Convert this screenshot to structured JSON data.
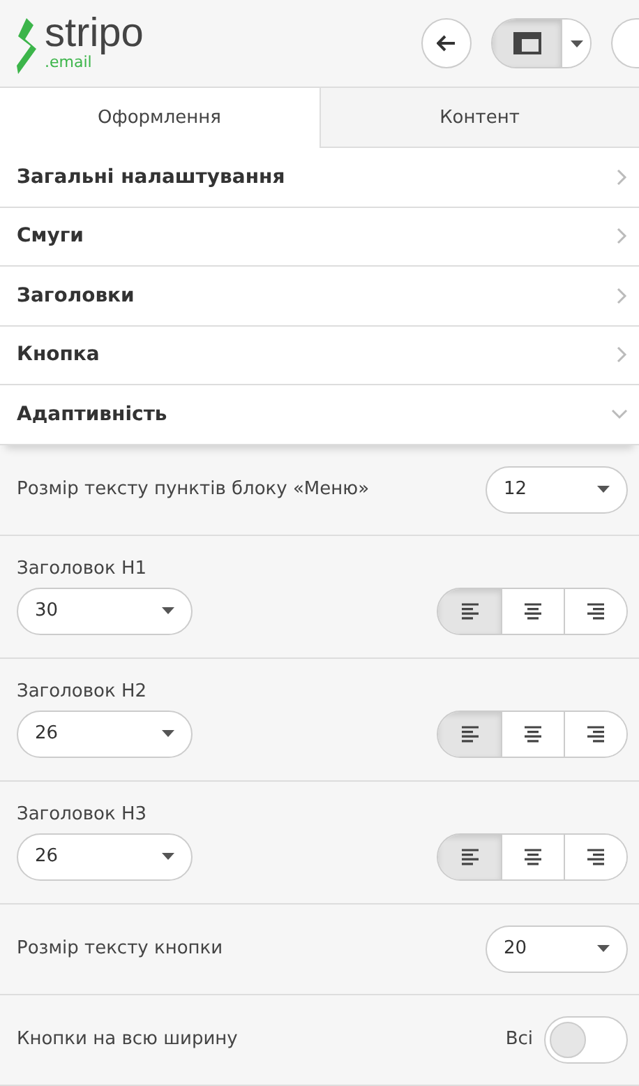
{
  "logo": {
    "name": "stripo",
    "suffix": ".email"
  },
  "toolbar": {
    "view_toggle": {
      "pressed": true
    }
  },
  "tabs": [
    {
      "label": "Оформлення",
      "selected": true
    },
    {
      "label": "Контент",
      "selected": false
    }
  ],
  "sections": [
    {
      "label": "Загальні налаштування",
      "expanded": false
    },
    {
      "label": "Смуги",
      "expanded": false
    },
    {
      "label": "Заголовки",
      "expanded": false
    },
    {
      "label": "Кнопка",
      "expanded": false
    },
    {
      "label": "Адаптивність",
      "expanded": true
    }
  ],
  "settings": [
    {
      "kind": "select",
      "label": "Розмір тексту пунктів блоку «Меню»",
      "value": "12"
    },
    {
      "kind": "heading",
      "label": "Заголовок H1",
      "value": "30",
      "align": [
        {
          "selected": true
        },
        {
          "selected": false
        },
        {
          "selected": false
        }
      ]
    },
    {
      "kind": "heading",
      "label": "Заголовок H2",
      "value": "26",
      "align": [
        {
          "selected": true
        },
        {
          "selected": false
        },
        {
          "selected": false
        }
      ]
    },
    {
      "kind": "heading",
      "label": "Заголовок H3",
      "value": "26",
      "align": [
        {
          "selected": true
        },
        {
          "selected": false
        },
        {
          "selected": false
        }
      ]
    },
    {
      "kind": "select",
      "label": "Розмір тексту кнопки",
      "value": "20"
    },
    {
      "kind": "toggle",
      "label": "Кнопки на всю ширину",
      "toggle_label": "Всі",
      "on": false
    }
  ]
}
